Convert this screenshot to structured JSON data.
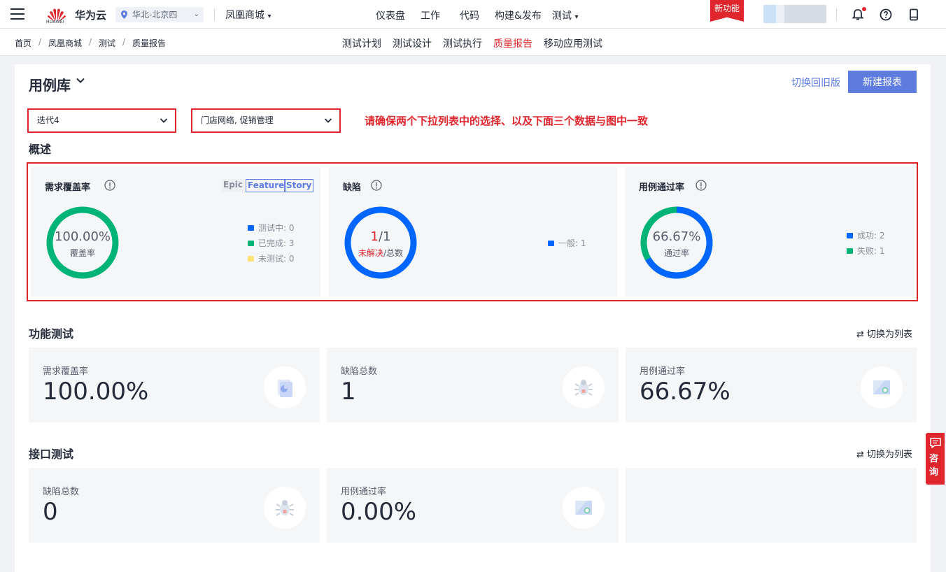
{
  "header": {
    "brand": "华为云",
    "logo_text": "HUAWEI",
    "region": "华北-北京四",
    "project": "凤凰商城",
    "nav": [
      "仪表盘",
      "工作",
      "代码",
      "构建&发布",
      "测试"
    ],
    "new_feature_badge": "新功能"
  },
  "breadcrumb": [
    "首页",
    "凤凰商城",
    "测试",
    "质量报告"
  ],
  "subnav": {
    "items": [
      "测试计划",
      "测试设计",
      "测试执行",
      "质量报告",
      "移动应用测试"
    ],
    "active": "质量报告"
  },
  "page": {
    "title": "用例库",
    "switch_old_label": "切换回旧版",
    "new_report_label": "新建报表"
  },
  "filters": {
    "iteration": "迭代4",
    "modules": "门店网络, 促销管理"
  },
  "note": "请确保两个下拉列表中的选择、以及下面三个数据与图中一致",
  "overview": {
    "section_title": "概述",
    "coverage": {
      "title": "需求覆盖率",
      "tags": [
        "Epic",
        "Feature",
        "Story"
      ],
      "value": "100.00%",
      "caption": "覆盖率",
      "fraction": 1.0,
      "legend": [
        {
          "label": "测试中:",
          "value": "0",
          "color": "#0066ff"
        },
        {
          "label": "已完成:",
          "value": "3",
          "color": "#00b377"
        },
        {
          "label": "未测试:",
          "value": "0",
          "color": "#ffe27a"
        }
      ]
    },
    "defects": {
      "title": "缺陷",
      "unresolved": "1",
      "total": "/1",
      "caption_unresolved": "未解决",
      "caption_total": "/总数",
      "legend": [
        {
          "label": "一般:",
          "value": "1",
          "color": "#0066ff"
        }
      ]
    },
    "pass_rate": {
      "title": "用例通过率",
      "value": "66.67%",
      "caption": "通过率",
      "fraction": 0.6667,
      "legend": [
        {
          "label": "成功:",
          "value": "2",
          "color": "#0066ff"
        },
        {
          "label": "失败:",
          "value": "1",
          "color": "#00b377"
        }
      ]
    }
  },
  "functional": {
    "section_title": "功能测试",
    "switch_label": "切换为列表",
    "cards": [
      {
        "label": "需求覆盖率",
        "value": "100.00%"
      },
      {
        "label": "缺陷总数",
        "value": "1"
      },
      {
        "label": "用例通过率",
        "value": "66.67%"
      }
    ]
  },
  "api": {
    "section_title": "接口测试",
    "switch_label": "切换为列表",
    "cards": [
      {
        "label": "缺陷总数",
        "value": "0"
      },
      {
        "label": "用例通过率",
        "value": "0.00%"
      }
    ]
  },
  "consult": "咨询",
  "colors": {
    "accent": "#5e7ce0",
    "red": "#e0262d",
    "blue": "#0066ff",
    "green": "#00b377",
    "yellow": "#ffe27a"
  }
}
